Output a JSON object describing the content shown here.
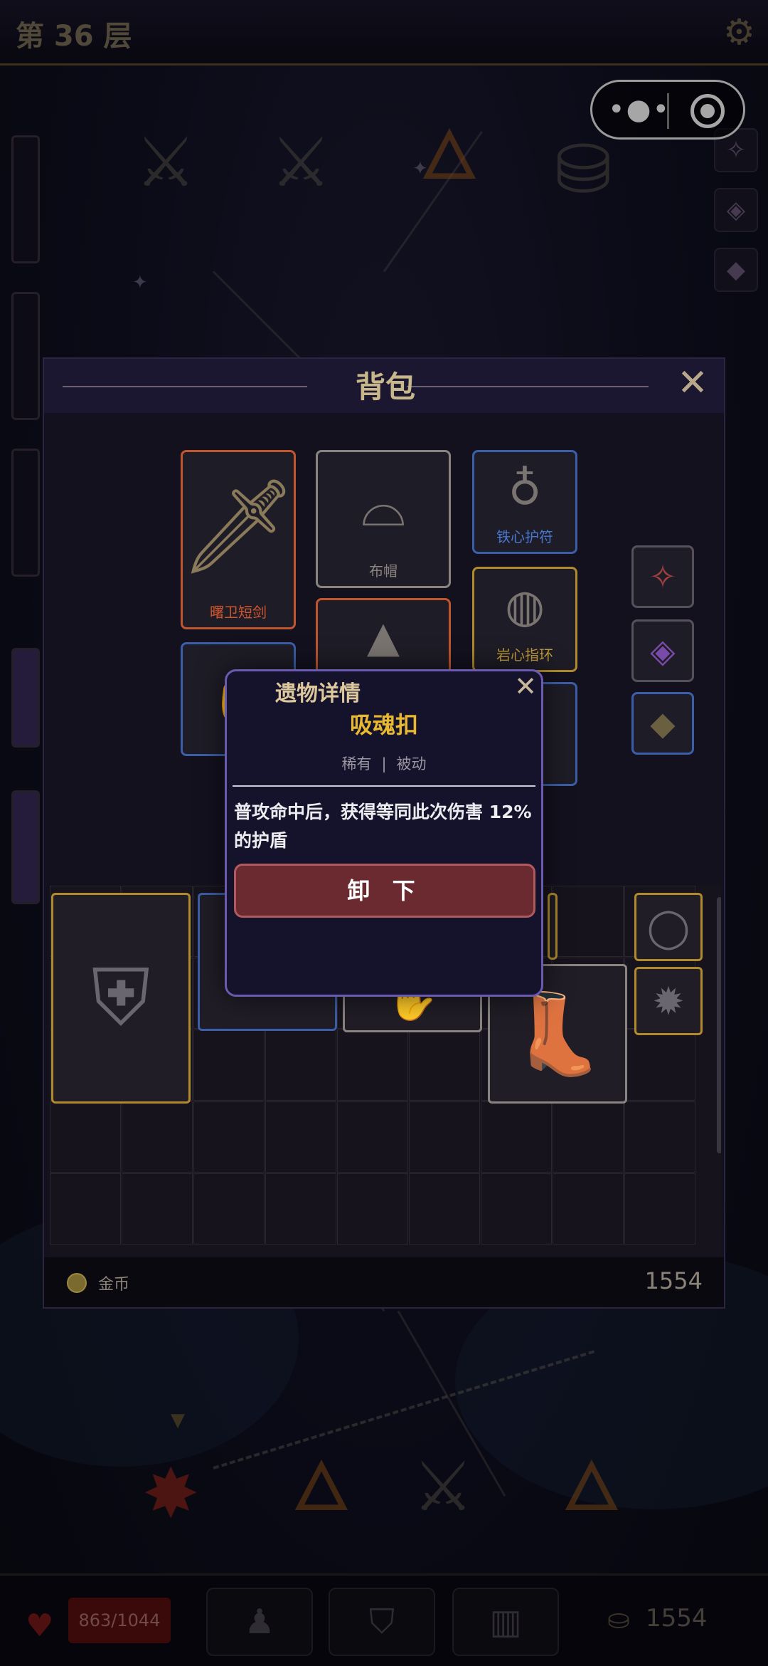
{
  "header": {
    "floor": "第 36 层"
  },
  "status": {
    "hp": "863/1044",
    "coins": "1554"
  },
  "backpack": {
    "title": "背包",
    "equipped": [
      {
        "name": "曙卫短剑",
        "rarity_color": "#c0552e",
        "name_color": "#d0552e",
        "icon": "sword-icon"
      },
      {
        "name": "布帽",
        "rarity_color": "#8a8480",
        "name_color": "#8a8480",
        "icon": "hat-icon"
      },
      {
        "name": "铁心护符",
        "rarity_color": "#3b5ea8",
        "name_color": "#4a78d0",
        "icon": "amulet-icon"
      },
      {
        "name": "岩心指环",
        "rarity_color": "#b08a2c",
        "name_color": "#c09a3c",
        "icon": "ring-icon"
      }
    ],
    "gold_label": "金币",
    "gold_value": "1554"
  },
  "popup": {
    "title": "遗物详情",
    "relic_name": "吸魂扣",
    "rarity": "稀有",
    "type": "被动",
    "description": "普攻命中后，获得等同此次伤害 12%的护盾",
    "unequip_button": "卸 下"
  }
}
